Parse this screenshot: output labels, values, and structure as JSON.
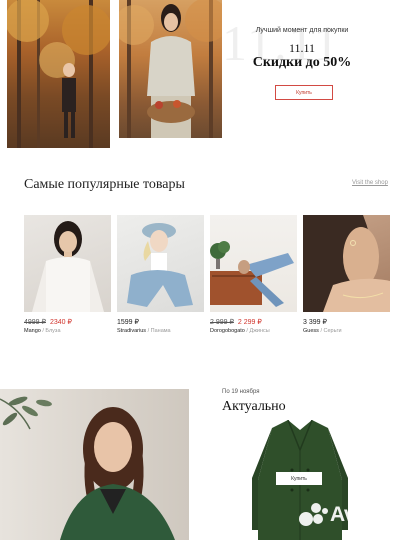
{
  "hero": {
    "watermark": "11.11",
    "kicker": "Лучший момент для покупки",
    "date": "11.11",
    "title": "Скидки до 50%",
    "buy_label": "Купить"
  },
  "popular": {
    "title": "Самые популярные товары",
    "shop_link": "Visit the shop",
    "products": [
      {
        "old_price": "4999 ₽",
        "price": "2340 ₽",
        "brand": "Mango",
        "category": "Блуза"
      },
      {
        "old_price": "",
        "price": "1599 ₽",
        "brand": "Stradivarius",
        "category": "Панама"
      },
      {
        "old_price": "2 999 ₽",
        "price": "2 299 ₽",
        "brand": "Dorogobogato",
        "category": "Джинсы"
      },
      {
        "old_price": "",
        "price": "3 399 ₽",
        "brand": "Guess",
        "category": "Серьги"
      }
    ]
  },
  "actual": {
    "kicker": "По 19 ноября",
    "title": "Актуально",
    "buy_label": "Купить"
  },
  "watermark": {
    "text": "Avito"
  },
  "colors": {
    "accent_red": "#d0342c",
    "coat_green": "#2f4f2a"
  }
}
